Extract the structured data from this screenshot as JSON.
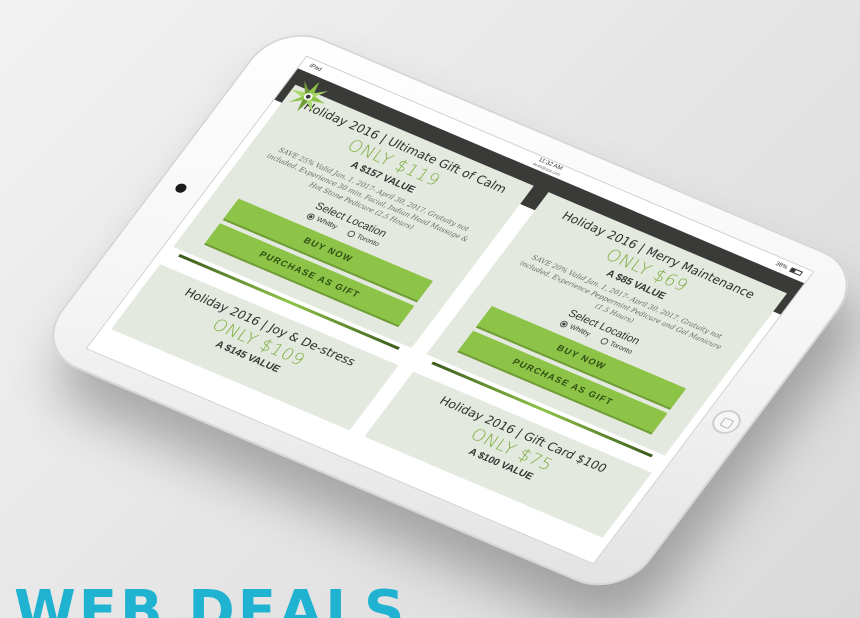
{
  "status_bar": {
    "device": "iPad",
    "time": "11:32 AM",
    "url": "deals@spa.com",
    "battery": "38%"
  },
  "nav": {
    "logo_icon": "star-leaf-logo",
    "menu_icon": "≡"
  },
  "deals": [
    {
      "title": "Holiday 2016 | Ultimate Gift of Calm",
      "price": "ONLY $119",
      "value": "A $157 VALUE",
      "description": "SAVE 25% Valid Jan. 1, 2017- April 30, 2017. Gratuity not included. Experience 30 min. Facial, Indian Head Massage & Hot Stone Pedicure (2.5 Hours)",
      "select_label": "Select Location",
      "locations": [
        "Whitby",
        "Toronto"
      ],
      "selected_location": "Whitby",
      "buy_label": "BUY NOW",
      "gift_label": "PURCHASE AS GIFT"
    },
    {
      "title": "Holiday 2016 | Merry Maintenance",
      "price": "ONLY $69",
      "value": "A $85 VALUE",
      "description": "SAVE 20% Valid Jan. 1, 2017- April 30, 2017. Gratuity not included. Experience Peppermint Pedicure and Gel Manicure (1.5 Hours)",
      "select_label": "Select Location",
      "locations": [
        "Whitby",
        "Toronto"
      ],
      "selected_location": "Whitby",
      "buy_label": "BUY NOW",
      "gift_label": "PURCHASE AS GIFT"
    },
    {
      "title": "Holiday 2016 | Joy & De-stress",
      "price": "ONLY $109",
      "value": "A $145 VALUE"
    },
    {
      "title": "Holiday 2016 | Gift Card $100",
      "price": "ONLY $75",
      "value": "A $100 VALUE"
    }
  ],
  "headline": "WEB DEALS",
  "colors": {
    "accent_green": "#8dc447",
    "price_green": "#7cad3f",
    "nav_dark": "#3a3a38",
    "card_bg": "#e3e9de",
    "headline_blue": "#1fb3d1"
  }
}
